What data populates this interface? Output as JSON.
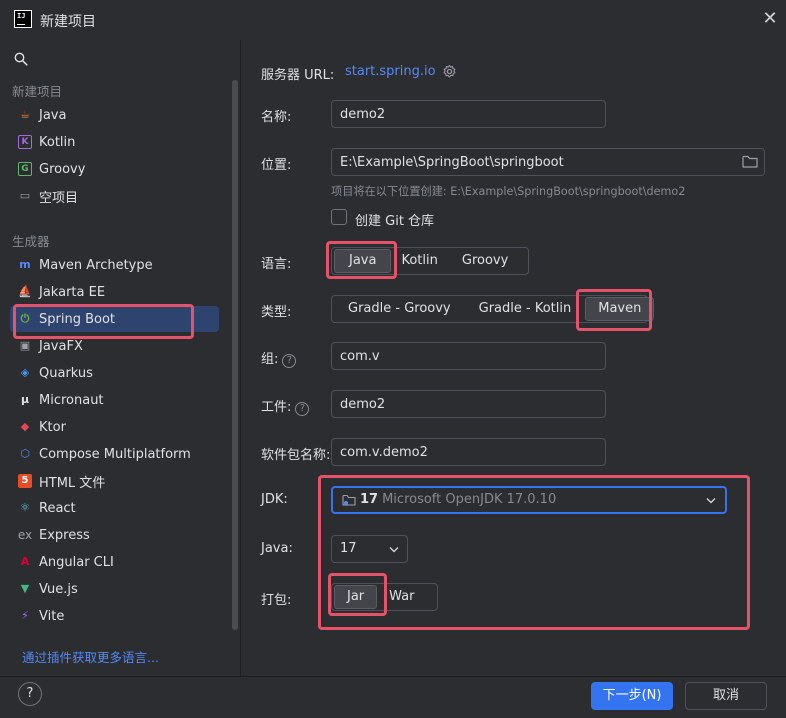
{
  "window": {
    "title": "新建项目",
    "close_glyph": "✕"
  },
  "sidebar": {
    "new_project_header": "新建项目",
    "generators_header": "生成器",
    "new_items": [
      {
        "label": "Java",
        "icon": "java-cup-icon",
        "color": "#e57e30"
      },
      {
        "label": "Kotlin",
        "icon": "kotlin-icon",
        "color": "#9f6bdf"
      },
      {
        "label": "Groovy",
        "icon": "groovy-icon",
        "color": "#5fb865"
      },
      {
        "label": "空项目",
        "icon": "empty-project-icon",
        "color": "#9da0a8"
      }
    ],
    "generator_items": [
      {
        "label": "Maven Archetype",
        "icon": "maven-icon",
        "color": "#548af7"
      },
      {
        "label": "Jakarta EE",
        "icon": "jakarta-ee-icon",
        "color": "#f2a93b"
      },
      {
        "label": "Spring Boot",
        "icon": "spring-boot-icon",
        "color": "#6db33f"
      },
      {
        "label": "JavaFX",
        "icon": "javafx-icon",
        "color": "#9da0a8"
      },
      {
        "label": "Quarkus",
        "icon": "quarkus-icon",
        "color": "#4695eb"
      },
      {
        "label": "Micronaut",
        "icon": "micronaut-icon",
        "color": "#dfe1e5"
      },
      {
        "label": "Ktor",
        "icon": "ktor-icon",
        "color": "#e44857"
      },
      {
        "label": "Compose Multiplatform",
        "icon": "compose-icon",
        "color": "#4695eb"
      },
      {
        "label": "HTML 文件",
        "icon": "html5-icon",
        "color": "#e44d26"
      },
      {
        "label": "React",
        "icon": "react-icon",
        "color": "#5fcbe8"
      },
      {
        "label": "Express",
        "icon": "express-icon",
        "color": "#9da0a8"
      },
      {
        "label": "Angular CLI",
        "icon": "angular-icon",
        "color": "#dd0031"
      },
      {
        "label": "Vue.js",
        "icon": "vue-icon",
        "color": "#41b883"
      },
      {
        "label": "Vite",
        "icon": "vite-icon",
        "color": "#a56bf7"
      }
    ],
    "selected": "Spring Boot",
    "more_plugins_link": "通过插件获取更多语言..."
  },
  "form": {
    "server_url_label": "服务器 URL:",
    "server_url_value": "start.spring.io",
    "name_label": "名称:",
    "name_value": "demo2",
    "location_label": "位置:",
    "location_value": "E:\\Example\\SpringBoot\\springboot",
    "location_hint": "项目将在以下位置创建: E:\\Example\\SpringBoot\\springboot\\demo2",
    "git_checkbox_label": "创建 Git 仓库",
    "git_checked": false,
    "language_label": "语言:",
    "languages": [
      "Java",
      "Kotlin",
      "Groovy"
    ],
    "language_selected": "Java",
    "type_label": "类型:",
    "types": [
      "Gradle - Groovy",
      "Gradle - Kotlin",
      "Maven"
    ],
    "type_selected": "Maven",
    "group_label": "组:",
    "group_value": "com.v",
    "artifact_label": "工件:",
    "artifact_value": "demo2",
    "package_label": "软件包名称:",
    "package_value": "com.v.demo2",
    "jdk_label": "JDK:",
    "jdk_version": "17",
    "jdk_name": "Microsoft OpenJDK 17.0.10",
    "java_label": "Java:",
    "java_value": "17",
    "packaging_label": "打包:",
    "packagings": [
      "Jar",
      "War"
    ],
    "packaging_selected": "Jar"
  },
  "footer": {
    "help_glyph": "?",
    "next_button": "下一步(N)",
    "cancel_button": "取消"
  },
  "colors": {
    "accent": "#3574f0",
    "highlight": "#e5536a",
    "selection": "#2e436e",
    "link": "#548af7"
  }
}
